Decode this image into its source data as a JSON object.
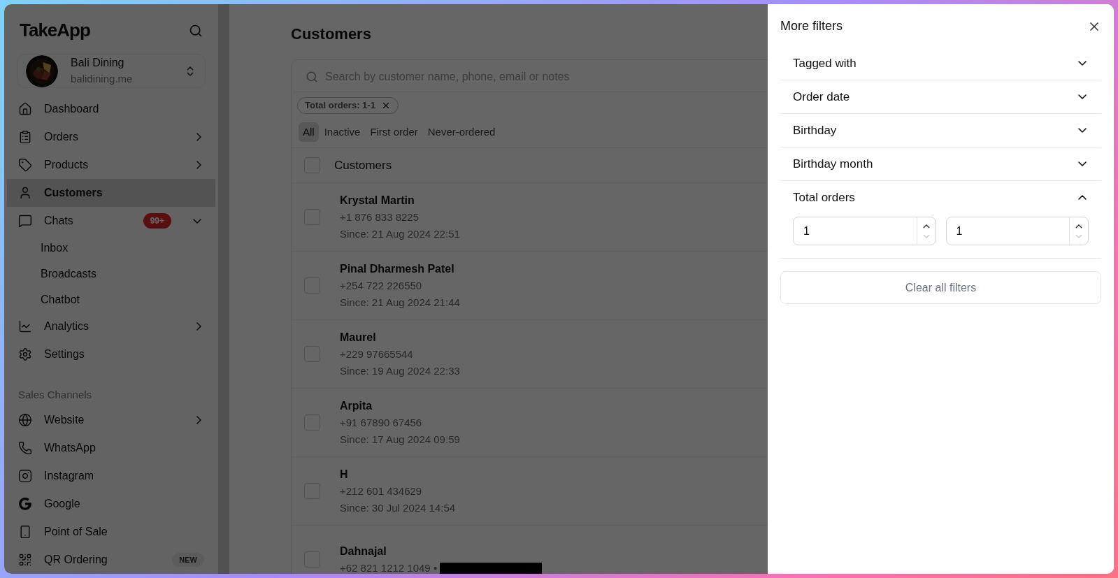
{
  "sidebar": {
    "brand": "TakeApp",
    "store": {
      "name": "Bali Dining",
      "domain": "balidining.me"
    },
    "items": [
      {
        "kind": "item",
        "label": "Dashboard",
        "selected": false
      },
      {
        "kind": "item",
        "label": "Orders",
        "expanded": false,
        "selected": false
      },
      {
        "kind": "item",
        "label": "Products",
        "expanded": false,
        "selected": false
      },
      {
        "kind": "item",
        "label": "Customers",
        "selected": true
      },
      {
        "kind": "item",
        "label": "Chats",
        "badge": "99+",
        "expanded": true,
        "selected": false
      },
      {
        "kind": "subitem",
        "label": "Inbox",
        "selected": false
      },
      {
        "kind": "subitem",
        "label": "Broadcasts",
        "selected": false
      },
      {
        "kind": "subitem",
        "label": "Chatbot",
        "selected": false
      },
      {
        "kind": "item",
        "label": "Analytics",
        "expanded": false,
        "selected": false
      },
      {
        "kind": "item",
        "label": "Settings",
        "selected": false
      },
      {
        "kind": "section",
        "label": "Sales Channels"
      },
      {
        "kind": "item",
        "label": "Website",
        "expanded": false,
        "selected": false
      },
      {
        "kind": "item",
        "label": "WhatsApp",
        "selected": false
      },
      {
        "kind": "item",
        "label": "Instagram",
        "selected": false
      },
      {
        "kind": "item",
        "label": "Google",
        "selected": false
      },
      {
        "kind": "item",
        "label": "Point of Sale",
        "selected": false
      },
      {
        "kind": "item",
        "label": "QR Ordering",
        "tag": "NEW",
        "selected": false
      }
    ]
  },
  "main": {
    "title": "Customers",
    "search": {
      "placeholder": "Search by customer name, phone, email or notes"
    },
    "chips": [
      "Total orders: 1-1"
    ],
    "tabs": [
      {
        "label": "All",
        "selected": true
      },
      {
        "label": "Inactive",
        "selected": false
      },
      {
        "label": "First order",
        "selected": false
      },
      {
        "label": "Never-ordered",
        "selected": false
      }
    ],
    "table": {
      "header": "Customers",
      "checked": false,
      "rows": [
        {
          "name": "Krystal Martin",
          "phone": "+1 876 833 8225",
          "since": "Since: 21 Aug 2024 22:51",
          "checked": false
        },
        {
          "name": "Pinal Dharmesh Patel",
          "phone": "+254 722 226550",
          "since": "Since: 21 Aug 2024 21:44",
          "checked": false
        },
        {
          "name": "Maurel",
          "phone": "+229 97665544",
          "since": "Since: 19 Aug 2024 22:33",
          "checked": false
        },
        {
          "name": "Arpita",
          "phone": "+91 67890 67456",
          "since": "Since: 17 Aug 2024 09:59",
          "checked": false
        },
        {
          "name": "H",
          "phone": "+212 601 434629",
          "since": "Since: 30 Jul 2024 14:54",
          "checked": false
        },
        {
          "name": "Dahnajal",
          "phone": "+62 821 1212 1049 •",
          "redacted": true,
          "checked": false
        }
      ]
    }
  },
  "drawer": {
    "title": "More filters",
    "sections": [
      {
        "label": "Tagged with",
        "expanded": false
      },
      {
        "label": "Order date",
        "expanded": false
      },
      {
        "label": "Birthday",
        "expanded": false
      },
      {
        "label": "Birthday month",
        "expanded": false
      },
      {
        "label": "Total orders",
        "expanded": true,
        "min": "1",
        "max": "1"
      }
    ],
    "clear_button": "Clear all filters"
  }
}
